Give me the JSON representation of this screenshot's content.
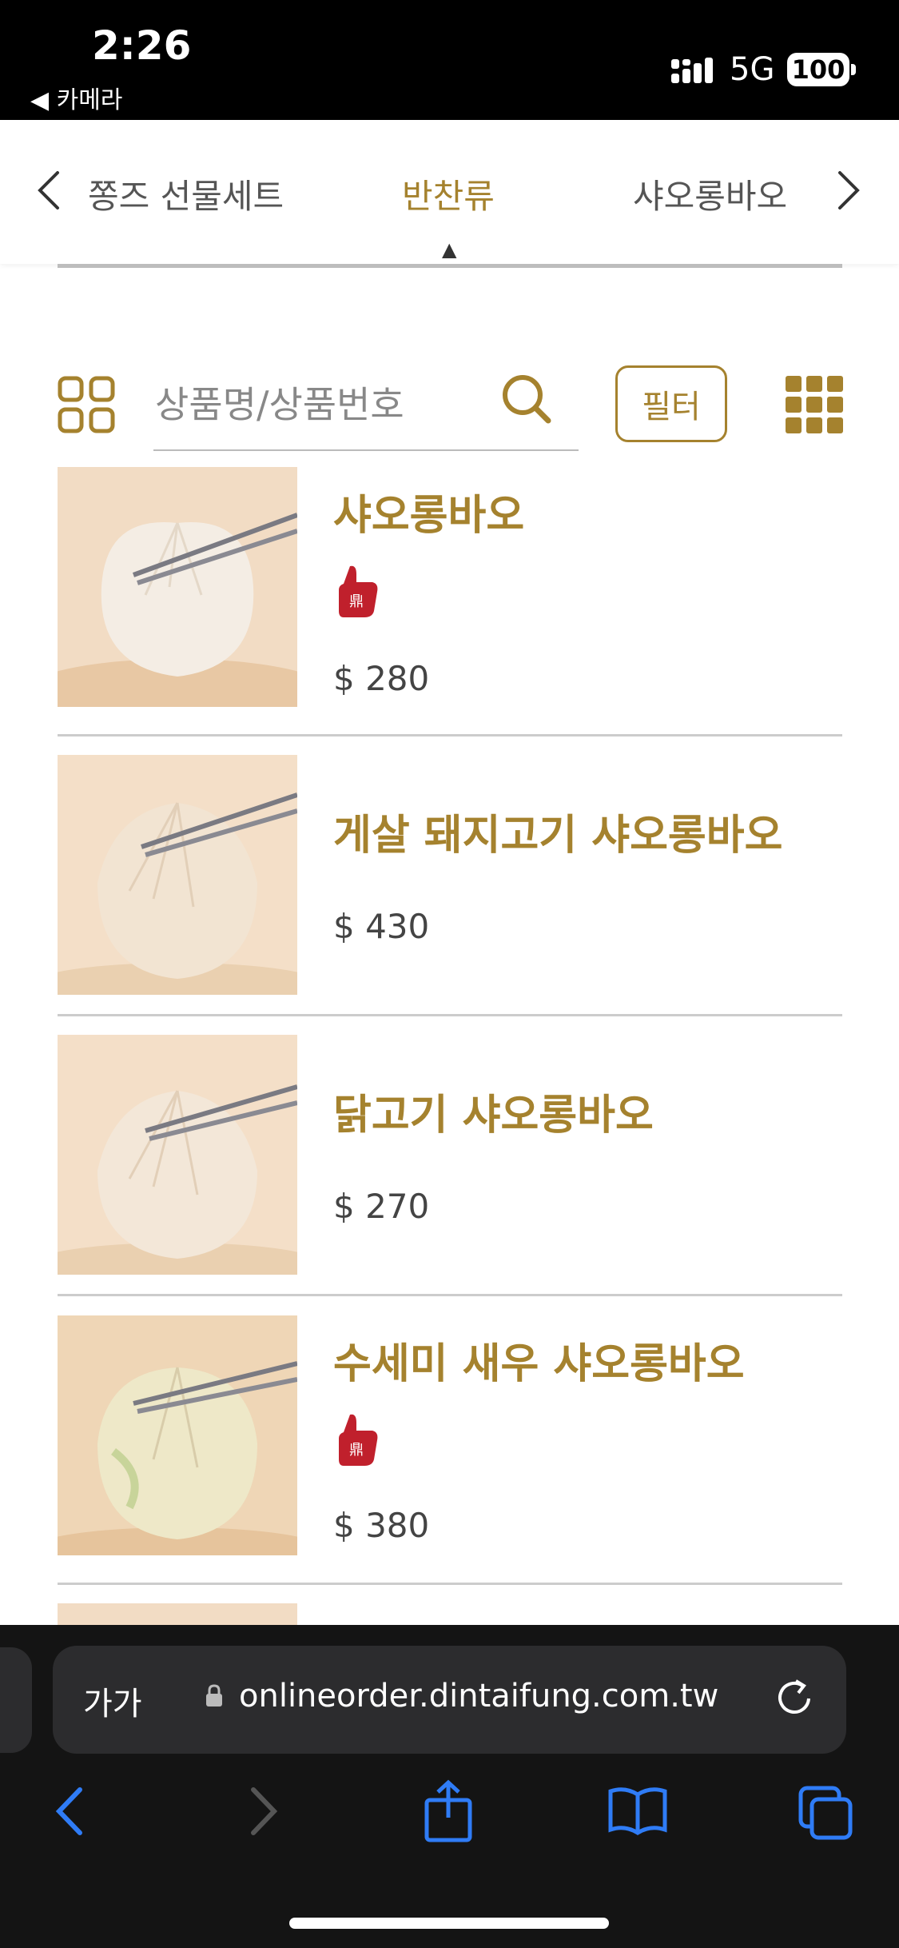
{
  "status": {
    "time": "2:26",
    "back_app": "◀ 카메라",
    "network": "5G",
    "battery": "100"
  },
  "category_nav": {
    "items": [
      "쫑즈 선물세트",
      "반찬류",
      "샤오롱바오"
    ],
    "active_index": 1
  },
  "search": {
    "placeholder": "상품명/상품번호",
    "filter_label": "필터"
  },
  "products": [
    {
      "name": "샤오롱바오",
      "price": "$ 280",
      "recommended": true
    },
    {
      "name": "게살 돼지고기 샤오롱바오",
      "price": "$ 430",
      "recommended": false
    },
    {
      "name": "닭고기 샤오롱바오",
      "price": "$ 270",
      "recommended": false
    },
    {
      "name": "수세미 새우 샤오롱바오",
      "price": "$ 380",
      "recommended": true
    }
  ],
  "browser": {
    "text_size_label": "가가",
    "url": "onlineorder.dintaifung.com.tw"
  },
  "colors": {
    "accent": "#a5822e",
    "badge": "#c0202c",
    "toolbar_blue": "#2f7cf6"
  }
}
